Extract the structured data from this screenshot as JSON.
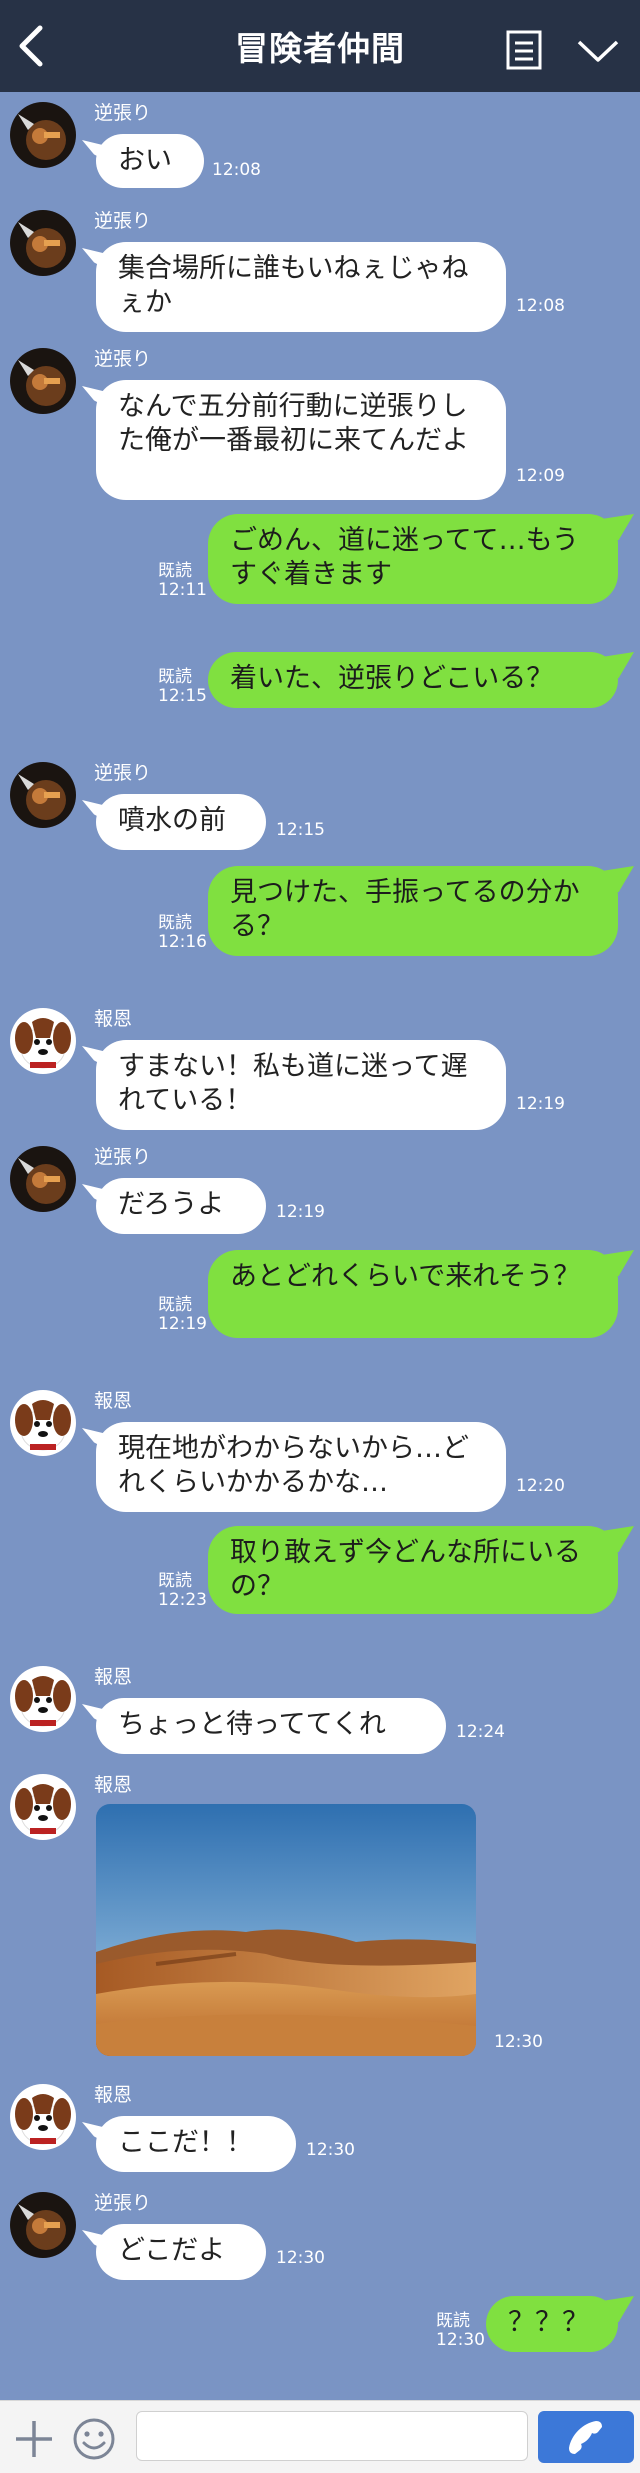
{
  "header": {
    "title": "冒険者仲間"
  },
  "read_label": "既読",
  "messages": [
    {
      "sender": "逆張り",
      "text": "おい",
      "time": "12:08"
    },
    {
      "sender": "逆張り",
      "text": "集合場所に誰もいねぇじゃねぇか",
      "time": "12:08"
    },
    {
      "sender": "逆張り",
      "text": "なんで五分前行動に逆張りした俺が一番最初に来てんだよ",
      "time": "12:09"
    },
    {
      "text": "ごめん、道に迷ってて…もうすぐ着きます",
      "time": "12:11",
      "read": "既読"
    },
    {
      "text": "着いた、逆張りどこいる？",
      "time": "12:15",
      "read": "既読"
    },
    {
      "sender": "逆張り",
      "text": "噴水の前",
      "time": "12:15"
    },
    {
      "text": "見つけた、手振ってるの分かる？",
      "time": "12:16",
      "read": "既読"
    },
    {
      "sender": "報恩",
      "text": "すまない！私も道に迷って遅れている！",
      "time": "12:19"
    },
    {
      "sender": "逆張り",
      "text": "だろうよ",
      "time": "12:19"
    },
    {
      "text": "あとどれくらいで来れそう？",
      "time": "12:19",
      "read": "既読"
    },
    {
      "sender": "報恩",
      "text": "現在地がわからないから…どれくらいかかるかな…",
      "time": "12:20"
    },
    {
      "text": "取り敢えず今どんな所にいるの？",
      "time": "12:23",
      "read": "既読"
    },
    {
      "sender": "報恩",
      "text": "ちょっと待っててくれ",
      "time": "12:24"
    },
    {
      "sender": "報恩",
      "image": "desert-photo",
      "time": "12:30"
    },
    {
      "sender": "報恩",
      "text": "ここだ！！",
      "time": "12:30"
    },
    {
      "sender": "逆張り",
      "text": "どこだよ",
      "time": "12:30"
    },
    {
      "text": "？？？",
      "time": "12:30",
      "read": "既読"
    }
  ],
  "input": {
    "placeholder": ""
  },
  "icons": {
    "back": "back-arrow-icon",
    "memo": "note-icon",
    "more": "chevron-down-icon",
    "plus": "plus-icon",
    "emoji": "emoji-icon",
    "call": "phone-icon"
  },
  "colors": {
    "header": "#273246",
    "background": "#7a94c4",
    "outgoing": "#80e040",
    "incoming": "#ffffff",
    "call": "#3c78d8"
  }
}
